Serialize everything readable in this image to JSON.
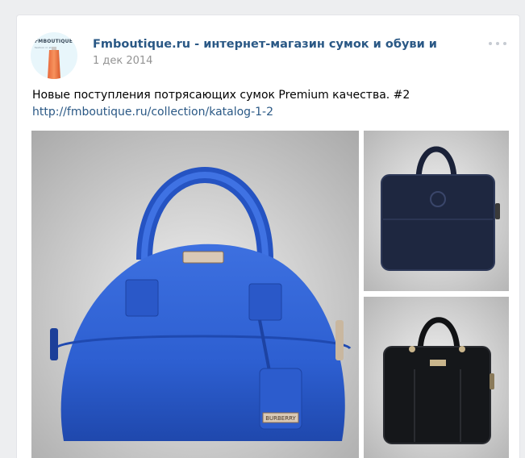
{
  "post": {
    "author": "Fmboutique.ru - интернет-магазин сумок и обуви и",
    "date": "1 дек 2014",
    "text": "Новые поступления потрясающих сумок Premium качества. #2",
    "link": "http://fmboutique.ru/collection/katalog-1-2",
    "avatar_brand": "FMBOUTIQUE",
    "avatar_tagline": "fashion in style"
  },
  "photos": [
    {
      "name": "blue-handbag-photo",
      "bag_color": "#2d5fd1",
      "tag_text": "BURBERRY"
    },
    {
      "name": "navy-briefcase-photo",
      "bag_color": "#1e2740"
    },
    {
      "name": "black-briefcase-photo",
      "bag_color": "#15171a"
    }
  ],
  "icons": [
    "more-options-icon"
  ],
  "colors": {
    "link": "#2a5885",
    "date": "#939393",
    "page_bg": "#edeef0"
  }
}
